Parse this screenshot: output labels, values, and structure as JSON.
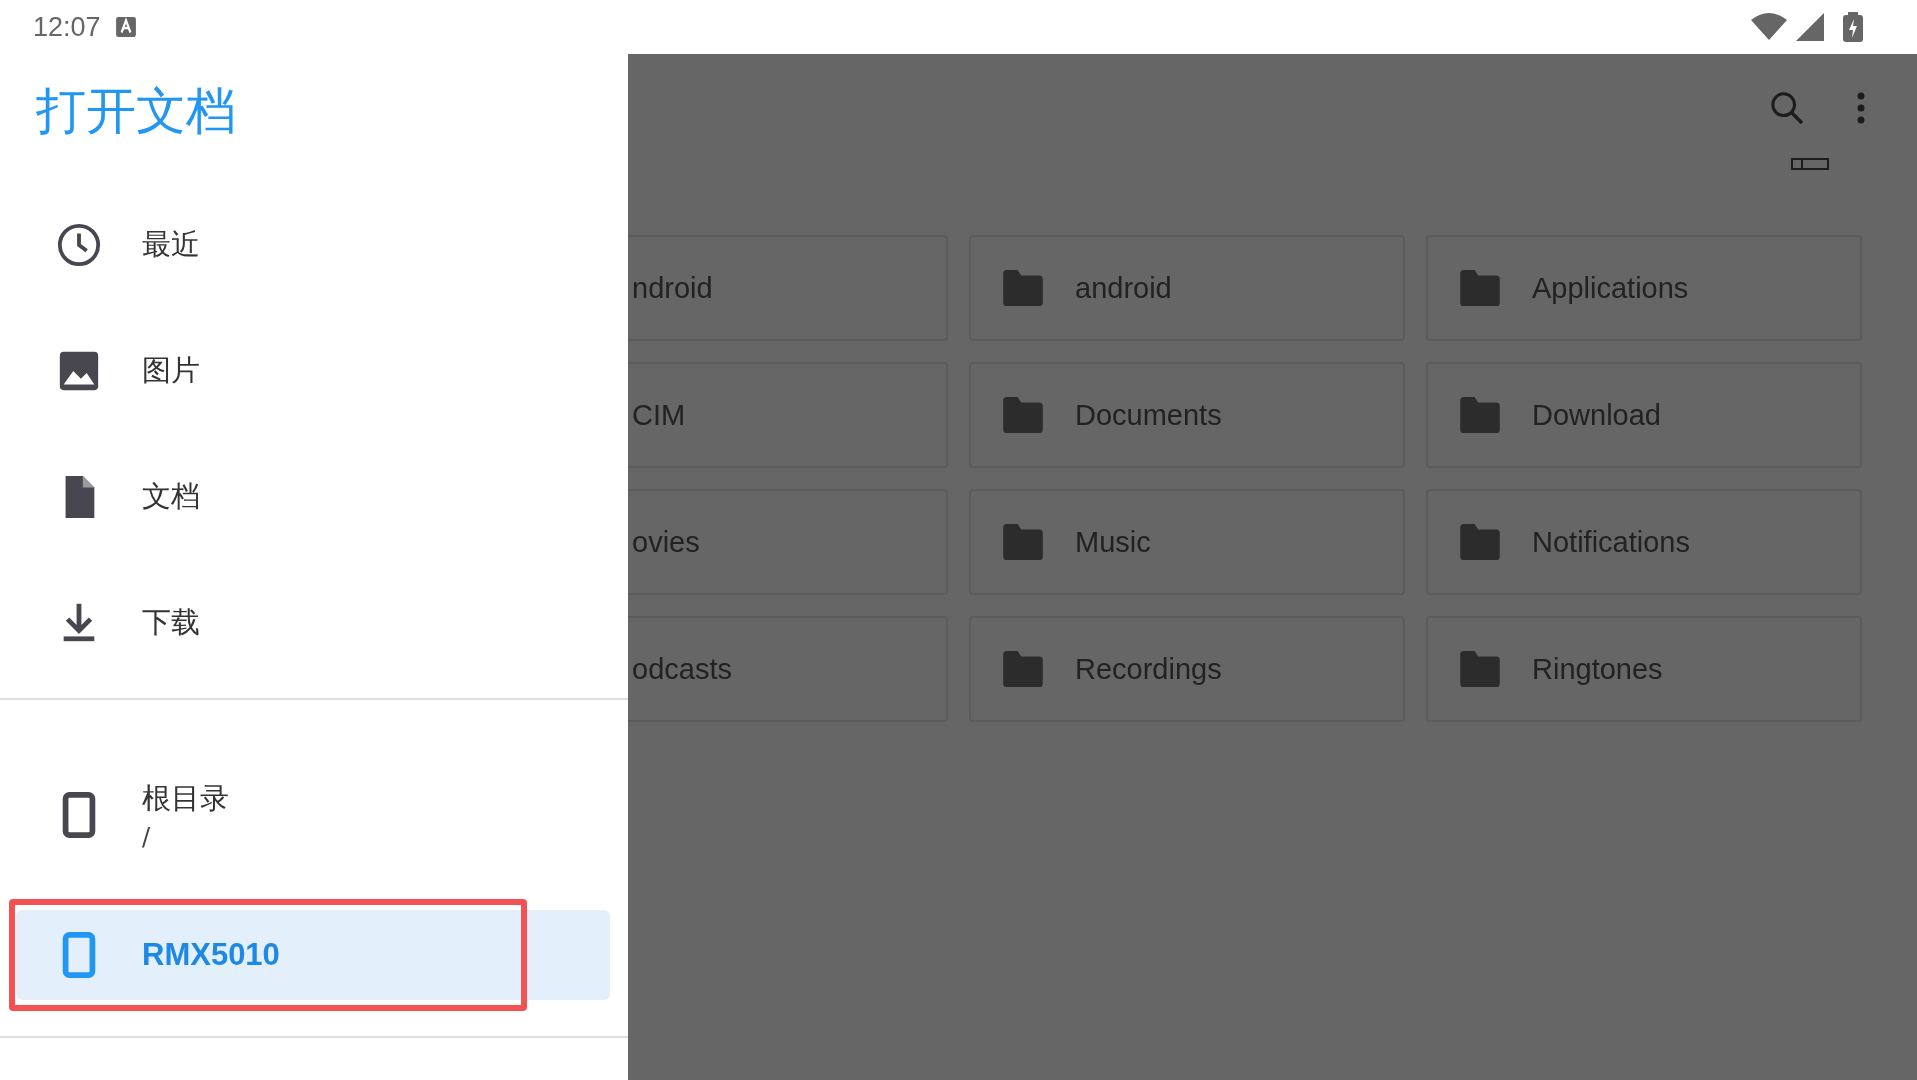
{
  "status_bar": {
    "time": "12:07"
  },
  "drawer": {
    "title": "打开文档",
    "categories": [
      {
        "label": "最近",
        "selected": false
      },
      {
        "label": "图片",
        "selected": false
      },
      {
        "label": "文档",
        "selected": false
      },
      {
        "label": "下载",
        "selected": false
      }
    ],
    "storage": [
      {
        "label": "根目录",
        "subtitle": "/",
        "selected": false,
        "highlighted": false
      },
      {
        "label": "RMX5010",
        "selected": true,
        "highlighted": true
      }
    ]
  },
  "folders": [
    {
      "name": "ndroid",
      "kind": "partial"
    },
    {
      "name": "android",
      "kind": "folder"
    },
    {
      "name": "Applications",
      "kind": "folder"
    },
    {
      "name": "CIM",
      "kind": "partial"
    },
    {
      "name": "Documents",
      "kind": "folder"
    },
    {
      "name": "Download",
      "kind": "folder"
    },
    {
      "name": "ovies",
      "kind": "partial"
    },
    {
      "name": "Music",
      "kind": "folder"
    },
    {
      "name": "Notifications",
      "kind": "folder"
    },
    {
      "name": "odcasts",
      "kind": "partial"
    },
    {
      "name": "Recordings",
      "kind": "folder"
    },
    {
      "name": "Ringtones",
      "kind": "folder"
    }
  ]
}
